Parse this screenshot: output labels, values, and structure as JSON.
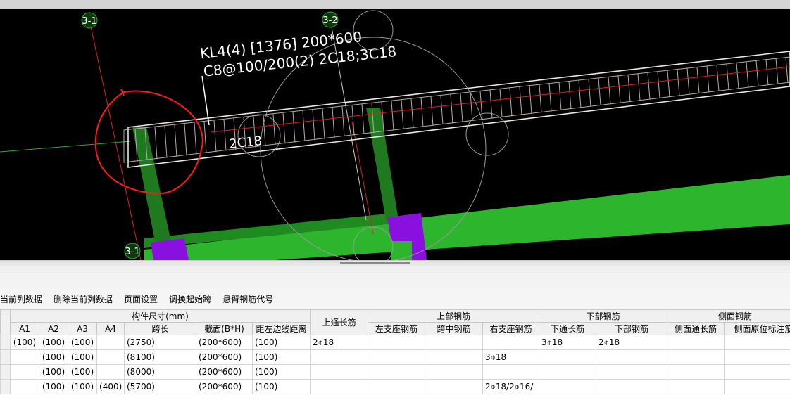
{
  "viewport": {
    "axis_labels": [
      "3-1",
      "3-2",
      "3-1"
    ],
    "beam_annotation_line1": "KL4(4) [1376] 200*600",
    "beam_annotation_line2": "C8@100/200(2) 2C18;3C18",
    "inplace_label": "2C18",
    "colors": {
      "background": "#000000",
      "beam": "#2db52d",
      "column": "#8a10e0",
      "rebar_cage": "#b9a9a9",
      "highlight_circle": "#ff1a1a",
      "axis_red": "#e02020"
    }
  },
  "toolbar": {
    "buttons": [
      "当前列数据",
      "删除当前列数据",
      "页面设置",
      "调换起始跨",
      "悬臂钢筋代号"
    ]
  },
  "table": {
    "group_headers": {
      "size": "构件尺寸(mm)",
      "top_through": "上通长筋",
      "top_rebar": "上部钢筋",
      "bottom_rebar": "下部钢筋",
      "side_rebar": "侧面钢筋"
    },
    "sub_headers": {
      "a1": "A1",
      "a2": "A2",
      "a3": "A3",
      "a4": "A4",
      "span_length": "跨长",
      "section": "截面(B*H)",
      "edge_distance": "距左边线距离",
      "left_support": "左支座钢筋",
      "mid_span": "跨中钢筋",
      "right_support": "右支座钢筋",
      "bottom_through": "下通长筋",
      "bottom_rebar": "下部钢筋",
      "side_through": "侧面通长筋",
      "side_inplace": "侧面原位标注筋"
    },
    "rows": [
      {
        "a1": "(100)",
        "a2": "(100)",
        "a3": "(100)",
        "a4": "",
        "span": "(2750)",
        "section": "(200*600)",
        "edge": "(100)",
        "top_through": "2⌽18",
        "left": "",
        "mid": "",
        "right": "",
        "bottom_through": "3⌽18",
        "bottom": "2⌽18",
        "side_through": "",
        "side_inplace": ""
      },
      {
        "a1": "",
        "a2": "(100)",
        "a3": "(100)",
        "a4": "",
        "span": "(8100)",
        "section": "(200*600)",
        "edge": "(100)",
        "top_through": "",
        "left": "",
        "mid": "",
        "right": "3⌽18",
        "bottom_through": "",
        "bottom": "",
        "side_through": "",
        "side_inplace": ""
      },
      {
        "a1": "",
        "a2": "(100)",
        "a3": "(100)",
        "a4": "",
        "span": "(8000)",
        "section": "(200*600)",
        "edge": "(100)",
        "top_through": "",
        "left": "",
        "mid": "",
        "right": "",
        "bottom_through": "",
        "bottom": "",
        "side_through": "",
        "side_inplace": ""
      },
      {
        "a1": "",
        "a2": "(100)",
        "a3": "(100)",
        "a4": "(400)",
        "span": "(5700)",
        "section": "(200*600)",
        "edge": "(100)",
        "top_through": "",
        "left": "",
        "mid": "",
        "right": "2⌽18/2⌽16/",
        "bottom_through": "",
        "bottom": "",
        "side_through": "",
        "side_inplace": ""
      }
    ]
  }
}
